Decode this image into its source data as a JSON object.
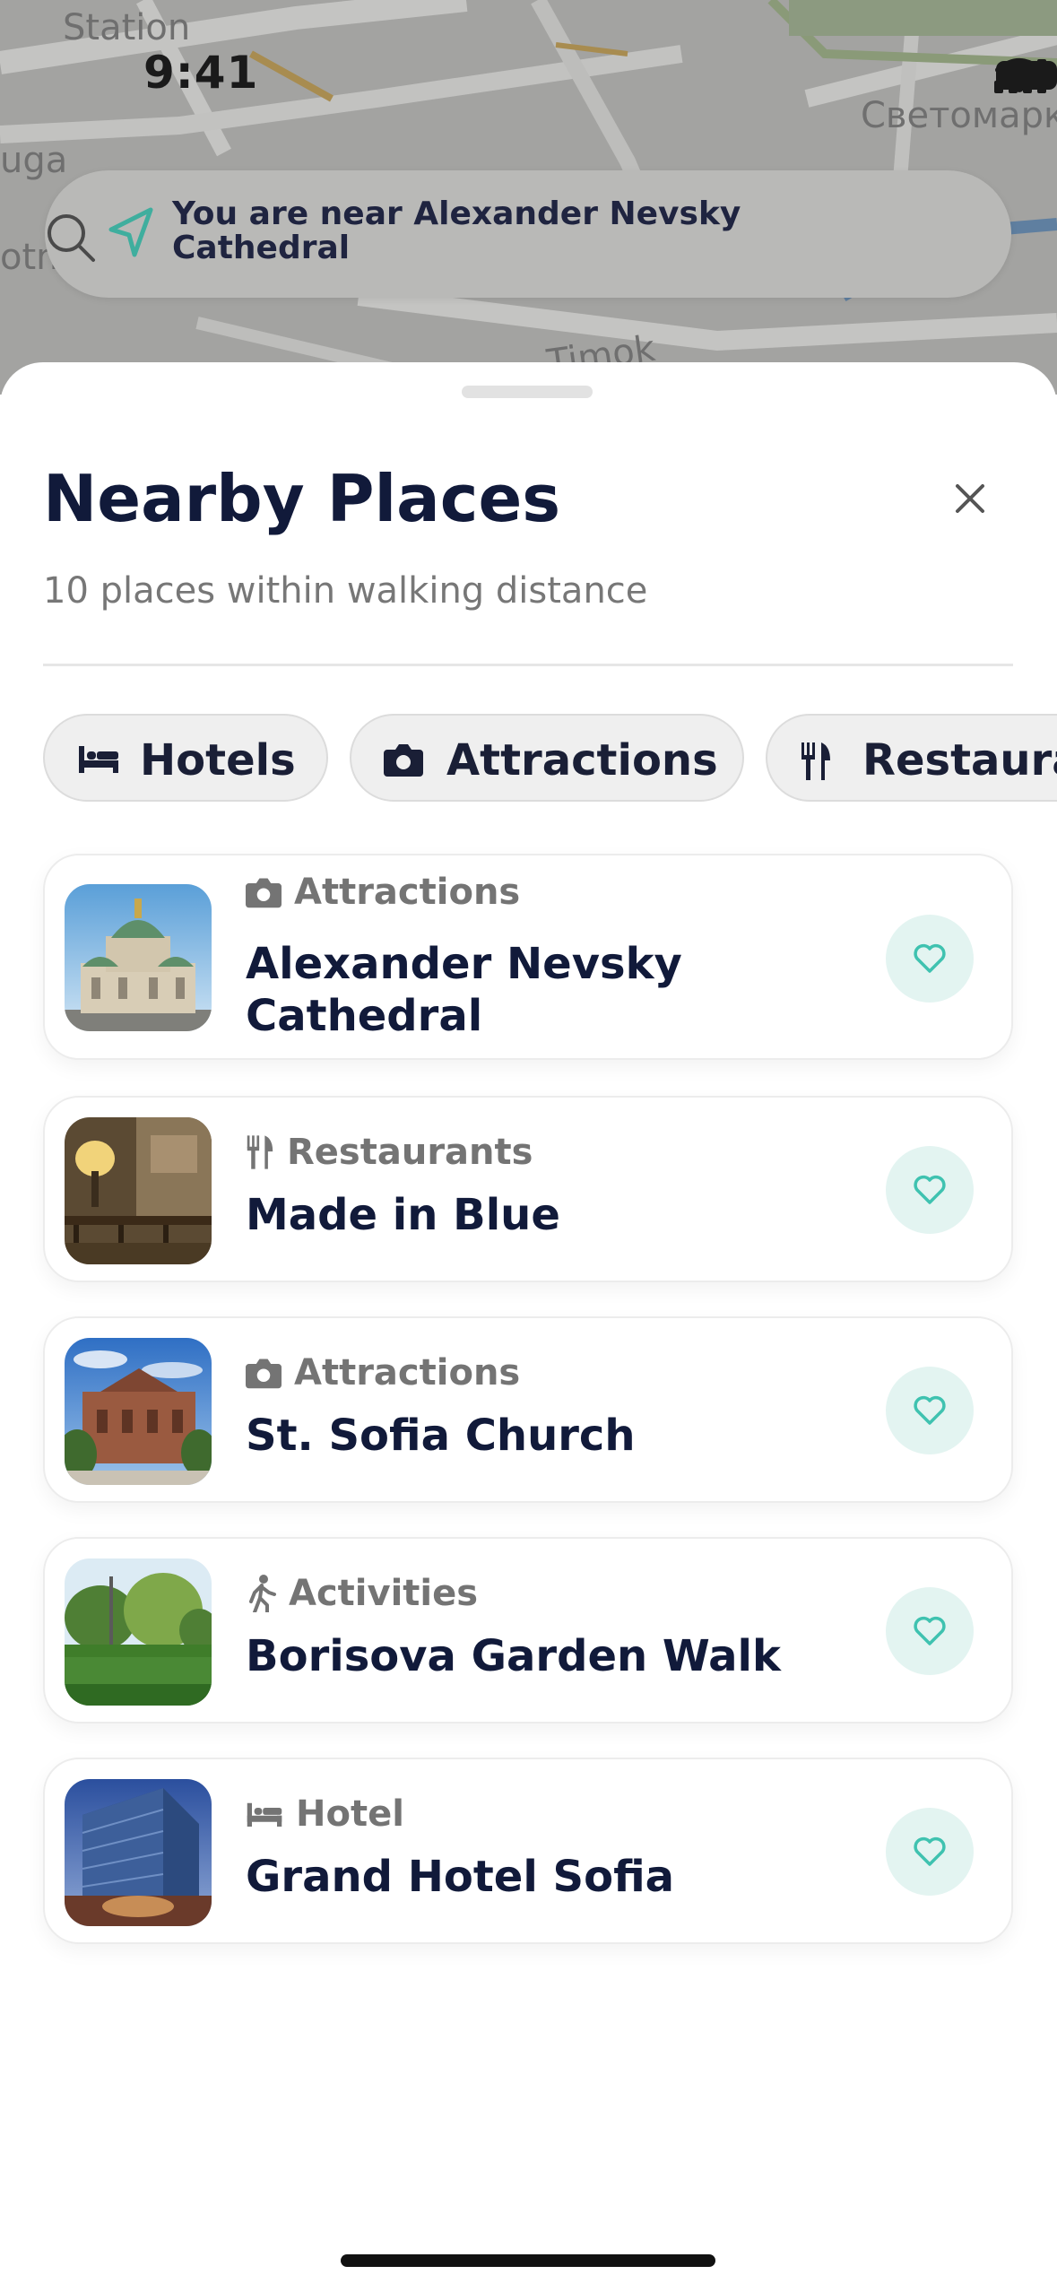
{
  "status_bar": {
    "time": "9:41"
  },
  "map": {
    "labels": [
      "Station",
      "uga",
      "otn",
      "Светомарк",
      "Timok"
    ]
  },
  "location_banner": {
    "text": "You are near  Alexander Nevsky Cathedral",
    "icons": {
      "navigation": "navigation-arrow-icon",
      "search": "search-icon"
    }
  },
  "sheet": {
    "title": "Nearby Places",
    "subtitle": "10 places within walking distance",
    "close_icon": "close-icon"
  },
  "filters": [
    {
      "label": "Hotels",
      "icon": "bed-icon"
    },
    {
      "label": "Attractions",
      "icon": "camera-icon"
    },
    {
      "label": "Restaura",
      "icon": "cutlery-icon"
    }
  ],
  "places": [
    {
      "category": "Attractions",
      "category_icon": "camera-icon",
      "name": "Alexander Nevsky Cathedral",
      "name_lines": [
        "Alexander Nevsky",
        "Cathedral"
      ],
      "thumb": "cathedral-photo"
    },
    {
      "category": "Restaurants",
      "category_icon": "cutlery-icon",
      "name": "Made in Blue",
      "thumb": "restaurant-photo"
    },
    {
      "category": "Attractions",
      "category_icon": "camera-icon",
      "name": "St. Sofia Church",
      "thumb": "church-photo"
    },
    {
      "category": "Activities",
      "category_icon": "walking-icon",
      "name": "Borisova Garden Walk",
      "thumb": "garden-photo"
    },
    {
      "category": "Hotel",
      "category_icon": "bed-icon",
      "name": "Grand Hotel Sofia",
      "thumb": "hotel-photo"
    }
  ],
  "colors": {
    "title": "#111a3a",
    "muted": "#777777",
    "accent": "#3fc2b0",
    "accent_soft": "#e3f4f1",
    "chip_bg": "#efefef"
  }
}
